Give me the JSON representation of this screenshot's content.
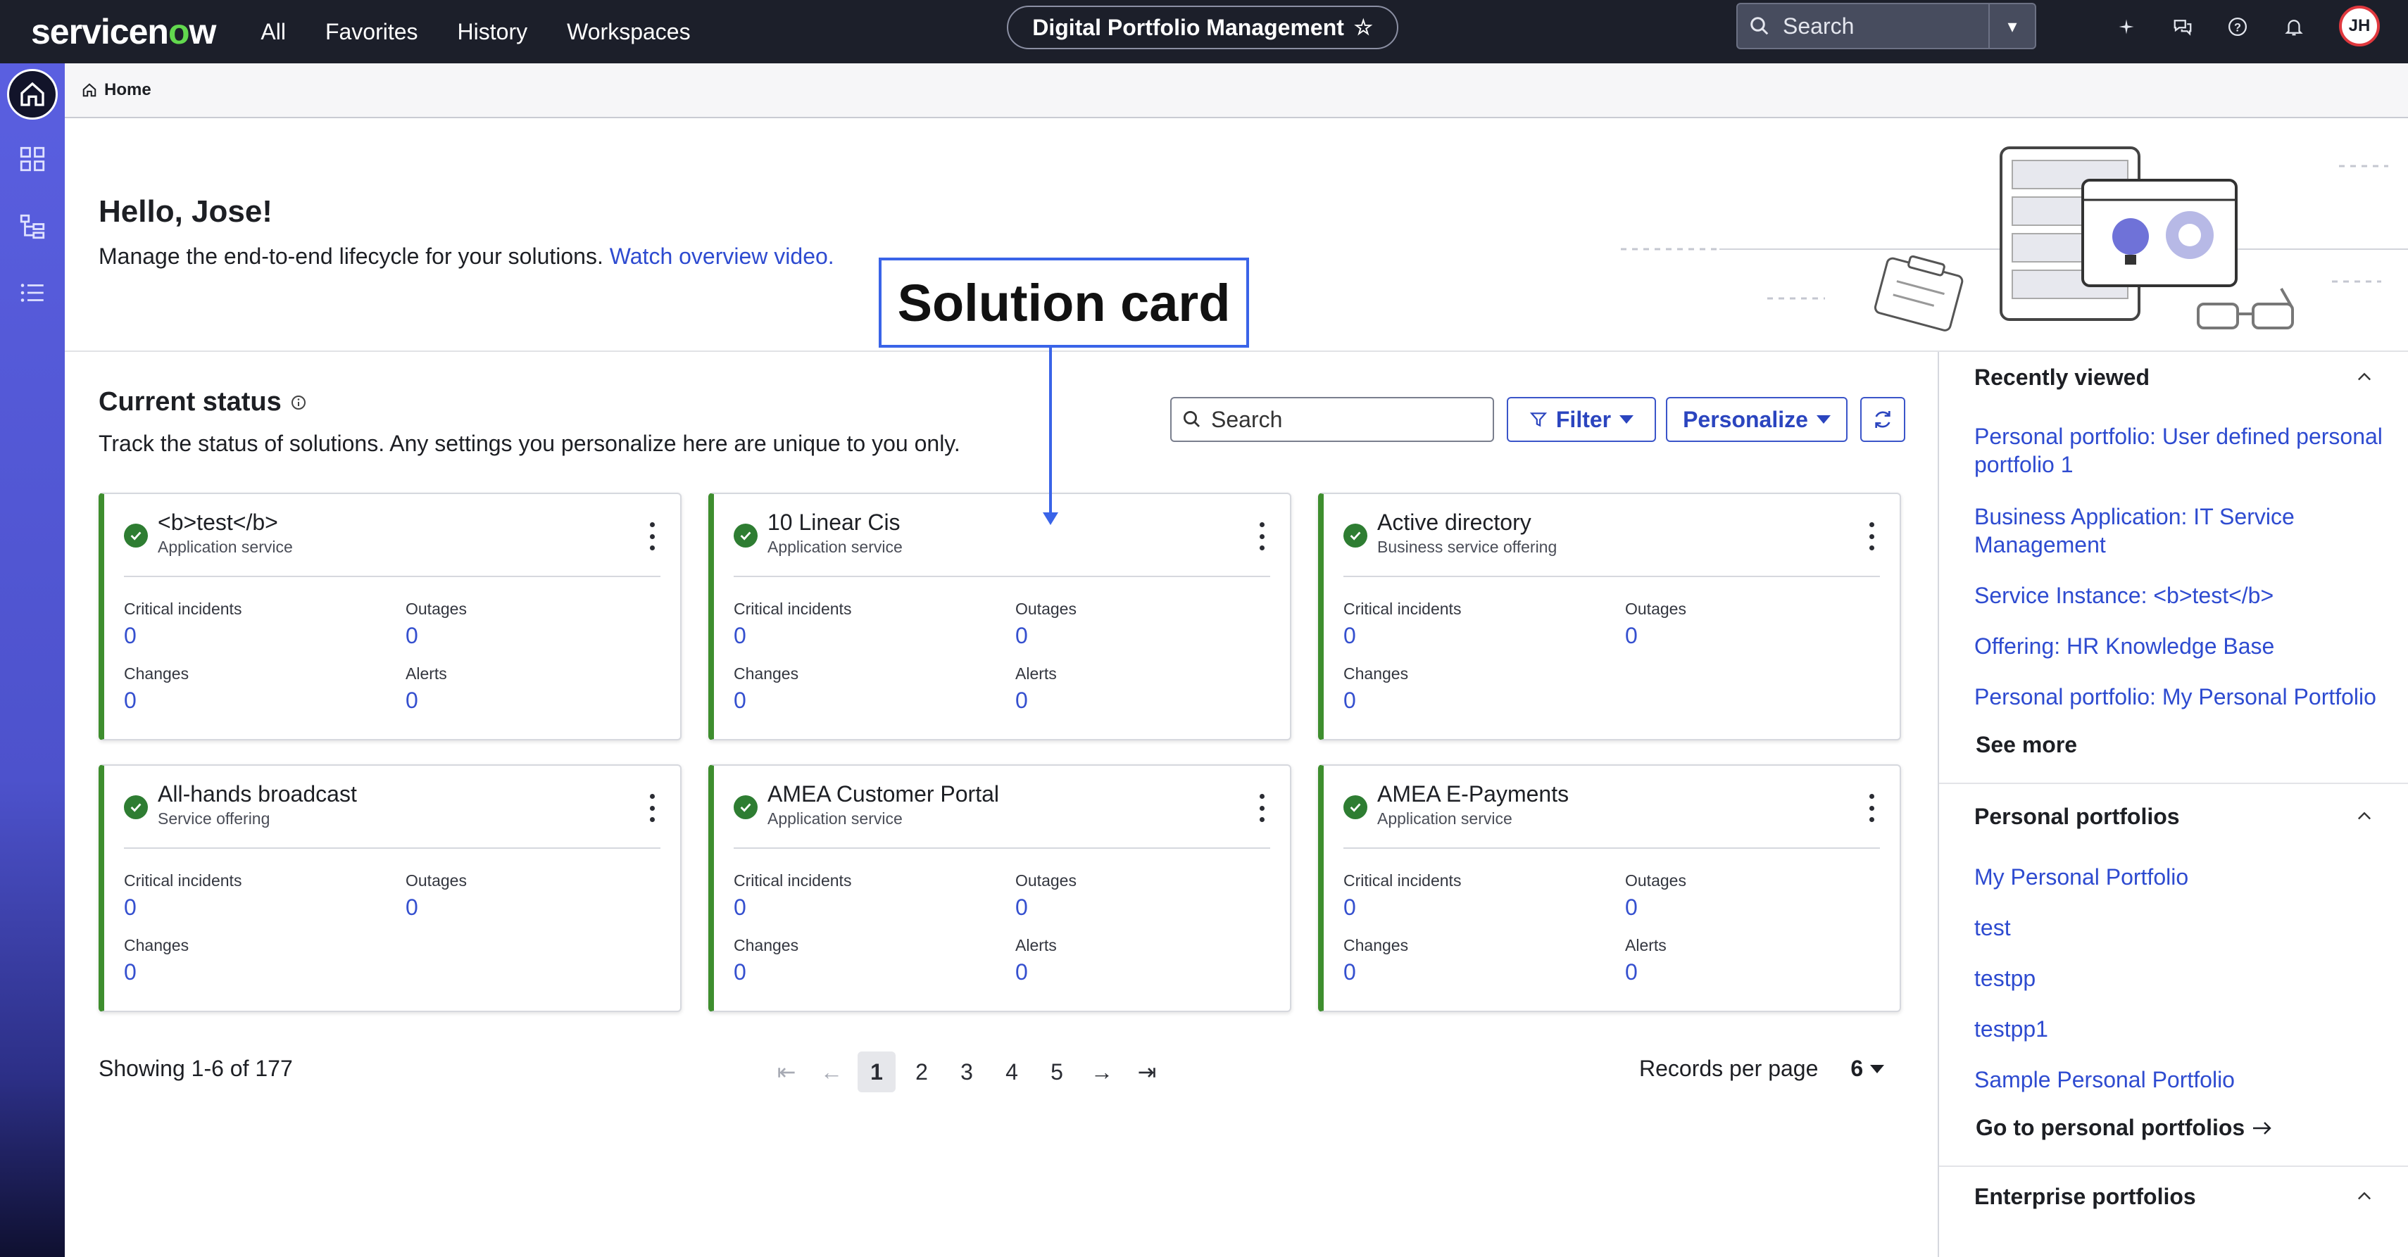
{
  "topnav": {
    "brand_a": "servicen",
    "brand_o": "o",
    "brand_b": "w",
    "links": [
      "All",
      "Favorites",
      "History",
      "Workspaces"
    ],
    "workspace_title": "Digital Portfolio Management",
    "search_placeholder": "Search",
    "avatar_initials": "JH"
  },
  "breadcrumb": {
    "home": "Home"
  },
  "hero": {
    "greeting": "Hello, Jose!",
    "subtitle": "Manage the end-to-end lifecycle for your solutions.",
    "video_link": "Watch overview video."
  },
  "annotation": {
    "label": "Solution card"
  },
  "status": {
    "title": "Current status",
    "subtitle": "Track the status of solutions. Any settings you personalize here are unique to you only.",
    "search_placeholder": "Search",
    "filter_label": "Filter",
    "personalize_label": "Personalize"
  },
  "cards": [
    {
      "title": "<b>test</b>",
      "type": "Application service",
      "metrics": [
        {
          "label": "Critical incidents",
          "value": "0"
        },
        {
          "label": "Outages",
          "value": "0"
        },
        {
          "label": "Changes",
          "value": "0"
        },
        {
          "label": "Alerts",
          "value": "0"
        }
      ]
    },
    {
      "title": "10 Linear Cis",
      "type": "Application service",
      "metrics": [
        {
          "label": "Critical incidents",
          "value": "0"
        },
        {
          "label": "Outages",
          "value": "0"
        },
        {
          "label": "Changes",
          "value": "0"
        },
        {
          "label": "Alerts",
          "value": "0"
        }
      ]
    },
    {
      "title": "Active directory",
      "type": "Business service offering",
      "metrics": [
        {
          "label": "Critical incidents",
          "value": "0"
        },
        {
          "label": "Outages",
          "value": "0"
        },
        {
          "label": "Changes",
          "value": "0"
        }
      ]
    },
    {
      "title": "All-hands broadcast",
      "type": "Service offering",
      "metrics": [
        {
          "label": "Critical incidents",
          "value": "0"
        },
        {
          "label": "Outages",
          "value": "0"
        },
        {
          "label": "Changes",
          "value": "0"
        }
      ]
    },
    {
      "title": "AMEA Customer Portal",
      "type": "Application service",
      "metrics": [
        {
          "label": "Critical incidents",
          "value": "0"
        },
        {
          "label": "Outages",
          "value": "0"
        },
        {
          "label": "Changes",
          "value": "0"
        },
        {
          "label": "Alerts",
          "value": "0"
        }
      ]
    },
    {
      "title": "AMEA E-Payments",
      "type": "Application service",
      "metrics": [
        {
          "label": "Critical incidents",
          "value": "0"
        },
        {
          "label": "Outages",
          "value": "0"
        },
        {
          "label": "Changes",
          "value": "0"
        },
        {
          "label": "Alerts",
          "value": "0"
        }
      ]
    }
  ],
  "pagination": {
    "showing": "Showing 1-6 of 177",
    "pages": [
      "1",
      "2",
      "3",
      "4",
      "5"
    ],
    "current": "1",
    "records_label": "Records per page",
    "records_value": "6"
  },
  "right_panel": {
    "recently_viewed_title": "Recently viewed",
    "recently_viewed": [
      "Personal portfolio: User defined personal portfolio 1",
      "Business Application: IT Service Management",
      "Service Instance: <b>test</b>",
      "Offering: HR Knowledge Base",
      "Personal portfolio: My Personal Portfolio"
    ],
    "see_more": "See more",
    "personal_title": "Personal portfolios",
    "personal": [
      "My Personal Portfolio",
      "test",
      "testpp",
      "testpp1",
      "Sample Personal Portfolio"
    ],
    "go_personal": "Go to personal portfolios",
    "enterprise_title": "Enterprise portfolios"
  }
}
